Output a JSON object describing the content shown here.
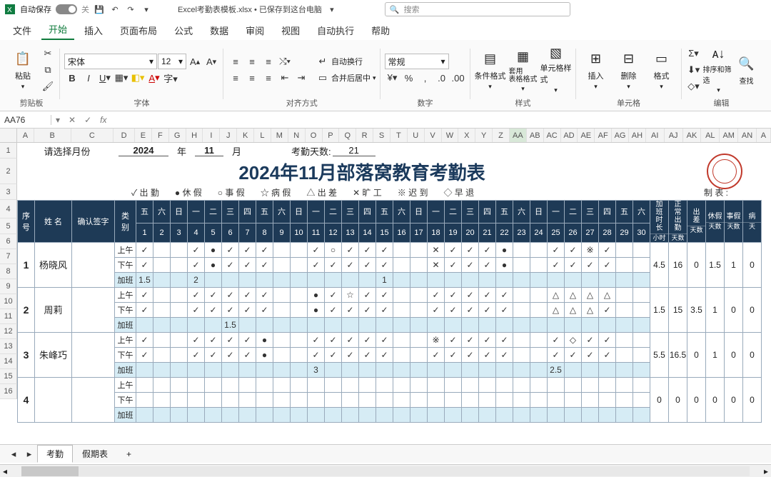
{
  "qat": {
    "autosave": "自动保存",
    "off": "关",
    "filename": "Excel考勤表模板.xlsx • 已保存到这台电脑",
    "search": "搜索"
  },
  "tabs": [
    "文件",
    "开始",
    "插入",
    "页面布局",
    "公式",
    "数据",
    "审阅",
    "视图",
    "自动执行",
    "帮助"
  ],
  "ribbon": {
    "clipboard": {
      "paste": "粘贴",
      "label": "剪贴板"
    },
    "font": {
      "name": "宋体",
      "size": "12",
      "label": "字体"
    },
    "align": {
      "wrap": "自动换行",
      "merge": "合并后居中",
      "label": "对齐方式"
    },
    "number": {
      "fmt": "常规",
      "label": "数字"
    },
    "styles": {
      "cond": "条件格式",
      "tbl": "套用\n表格格式",
      "cell": "单元格样式",
      "label": "样式"
    },
    "cells": {
      "ins": "插入",
      "del": "删除",
      "fmt": "格式",
      "label": "单元格"
    },
    "edit": {
      "sort": "排序和筛选",
      "find": "查找",
      "label": "编辑"
    }
  },
  "fx": {
    "name": "AA76"
  },
  "cols": [
    "A",
    "B",
    "C",
    "D",
    "E",
    "F",
    "G",
    "H",
    "I",
    "J",
    "K",
    "L",
    "M",
    "N",
    "O",
    "P",
    "Q",
    "R",
    "S",
    "T",
    "U",
    "V",
    "W",
    "X",
    "Y",
    "Z",
    "AA",
    "AB",
    "AC",
    "AD",
    "AE",
    "AF",
    "AG",
    "AH",
    "AI",
    "AJ",
    "AK",
    "AL",
    "AM",
    "AN",
    "A"
  ],
  "pick": {
    "label": "请选择月份",
    "year": "2024",
    "ylab": "年",
    "month": "11",
    "mlab": "月",
    "dayslab": "考勤天数:",
    "days": "21"
  },
  "title": "2024年11月部落窝教育考勤表",
  "legend": [
    "✓ 出 勤",
    "● 休 假",
    "○ 事 假",
    "☆ 病 假",
    "△ 出 差",
    "✕ 旷 工",
    "※ 迟 到",
    "◇ 早 退"
  ],
  "legend_r": "制 表 :",
  "head": {
    "seq": "序\n号",
    "name": "姓 名",
    "sign": "确认签字",
    "type": "类\n别",
    "wd": [
      "五",
      "六",
      "日",
      "一",
      "二",
      "三",
      "四",
      "五",
      "六",
      "日",
      "一",
      "二",
      "三",
      "四",
      "五",
      "六",
      "日",
      "一",
      "二",
      "三",
      "四",
      "五",
      "六",
      "日",
      "一",
      "二",
      "三",
      "四",
      "五",
      "六"
    ],
    "dn": [
      "1",
      "2",
      "3",
      "4",
      "5",
      "6",
      "7",
      "8",
      "9",
      "10",
      "11",
      "12",
      "13",
      "14",
      "15",
      "16",
      "17",
      "18",
      "19",
      "20",
      "21",
      "22",
      "23",
      "24",
      "25",
      "26",
      "27",
      "28",
      "29",
      "30"
    ],
    "sum": [
      "加\n班\n时\n长",
      "正\n常\n出\n勤",
      "出\n差",
      "休假",
      "事假",
      "病"
    ],
    "su": [
      "小时",
      "天数",
      "天数",
      "天数",
      "天数",
      "天"
    ]
  },
  "rows": [
    {
      "seq": "1",
      "name": "杨晓风",
      "am": [
        "✓",
        "",
        "",
        "✓",
        "●",
        "✓",
        "✓",
        "✓",
        "",
        "",
        "✓",
        "○",
        "✓",
        "✓",
        "✓",
        "",
        "",
        "✕",
        "✓",
        "✓",
        "✓",
        "●",
        "",
        "",
        "✓",
        "✓",
        "※",
        "✓",
        "",
        ""
      ],
      "pm": [
        "✓",
        "",
        "",
        "✓",
        "●",
        "✓",
        "✓",
        "✓",
        "",
        "",
        "✓",
        "✓",
        "✓",
        "✓",
        "✓",
        "",
        "",
        "✕",
        "✓",
        "✓",
        "✓",
        "●",
        "",
        "",
        "✓",
        "✓",
        "✓",
        "✓",
        "",
        ""
      ],
      "ot": [
        "1.5",
        "",
        "",
        "2",
        "",
        "",
        "",
        "",
        "",
        "",
        "",
        "",
        "",
        "",
        "1",
        "",
        "",
        "",
        "",
        "",
        "",
        "",
        "",
        "",
        "",
        "",
        "",
        "",
        "",
        ""
      ],
      "sum": [
        "4.5",
        "16",
        "0",
        "1.5",
        "1",
        "0"
      ]
    },
    {
      "seq": "2",
      "name": "周莉",
      "am": [
        "✓",
        "",
        "",
        "✓",
        "✓",
        "✓",
        "✓",
        "✓",
        "",
        "",
        "●",
        "✓",
        "☆",
        "✓",
        "✓",
        "",
        "",
        "✓",
        "✓",
        "✓",
        "✓",
        "✓",
        "",
        "",
        "△",
        "△",
        "△",
        "△",
        "",
        ""
      ],
      "pm": [
        "✓",
        "",
        "",
        "✓",
        "✓",
        "✓",
        "✓",
        "✓",
        "",
        "",
        "●",
        "✓",
        "✓",
        "✓",
        "✓",
        "",
        "",
        "✓",
        "✓",
        "✓",
        "✓",
        "✓",
        "",
        "",
        "△",
        "△",
        "△",
        "✓",
        "",
        ""
      ],
      "ot": [
        "",
        "",
        "",
        "",
        "",
        "1.5",
        "",
        "",
        "",
        "",
        "",
        "",
        "",
        "",
        "",
        "",
        "",
        "",
        "",
        "",
        "",
        "",
        "",
        "",
        "",
        "",
        "",
        "",
        "",
        ""
      ],
      "sum": [
        "1.5",
        "15",
        "3.5",
        "1",
        "0",
        "0"
      ]
    },
    {
      "seq": "3",
      "name": "朱峰巧",
      "am": [
        "✓",
        "",
        "",
        "✓",
        "✓",
        "✓",
        "✓",
        "●",
        "",
        "",
        "✓",
        "✓",
        "✓",
        "✓",
        "✓",
        "",
        "",
        "※",
        "✓",
        "✓",
        "✓",
        "✓",
        "",
        "",
        "✓",
        "◇",
        "✓",
        "✓",
        "",
        ""
      ],
      "pm": [
        "✓",
        "",
        "",
        "✓",
        "✓",
        "✓",
        "✓",
        "●",
        "",
        "",
        "✓",
        "✓",
        "✓",
        "✓",
        "✓",
        "",
        "",
        "✓",
        "✓",
        "✓",
        "✓",
        "✓",
        "",
        "",
        "✓",
        "✓",
        "✓",
        "✓",
        "",
        ""
      ],
      "ot": [
        "",
        "",
        "",
        "",
        "",
        "",
        "",
        "",
        "",
        "",
        "3",
        "",
        "",
        "",
        "",
        "",
        "",
        "",
        "",
        "",
        "",
        "",
        "",
        "",
        "2.5",
        "",
        "",
        "",
        "",
        ""
      ],
      "sum": [
        "5.5",
        "16.5",
        "0",
        "1",
        "0",
        "0"
      ]
    },
    {
      "seq": "4",
      "name": "",
      "am": [
        "",
        "",
        "",
        "",
        "",
        "",
        "",
        "",
        "",
        "",
        "",
        "",
        "",
        "",
        "",
        "",
        "",
        "",
        "",
        "",
        "",
        "",
        "",
        "",
        "",
        "",
        "",
        "",
        "",
        ""
      ],
      "pm": [
        "",
        "",
        "",
        "",
        "",
        "",
        "",
        "",
        "",
        "",
        "",
        "",
        "",
        "",
        "",
        "",
        "",
        "",
        "",
        "",
        "",
        "",
        "",
        "",
        "",
        "",
        "",
        "",
        "",
        ""
      ],
      "ot": [
        "",
        "",
        "",
        "",
        "",
        "",
        "",
        "",
        "",
        "",
        "",
        "",
        "",
        "",
        "",
        "",
        "",
        "",
        "",
        "",
        "",
        "",
        "",
        "",
        "",
        "",
        "",
        "",
        "",
        ""
      ],
      "sum": [
        "0",
        "0",
        "0",
        "0",
        "0",
        "0"
      ]
    }
  ],
  "types": {
    "am": "上午",
    "pm": "下午",
    "ot": "加班"
  },
  "sheets": [
    "考勤",
    "假期表"
  ]
}
